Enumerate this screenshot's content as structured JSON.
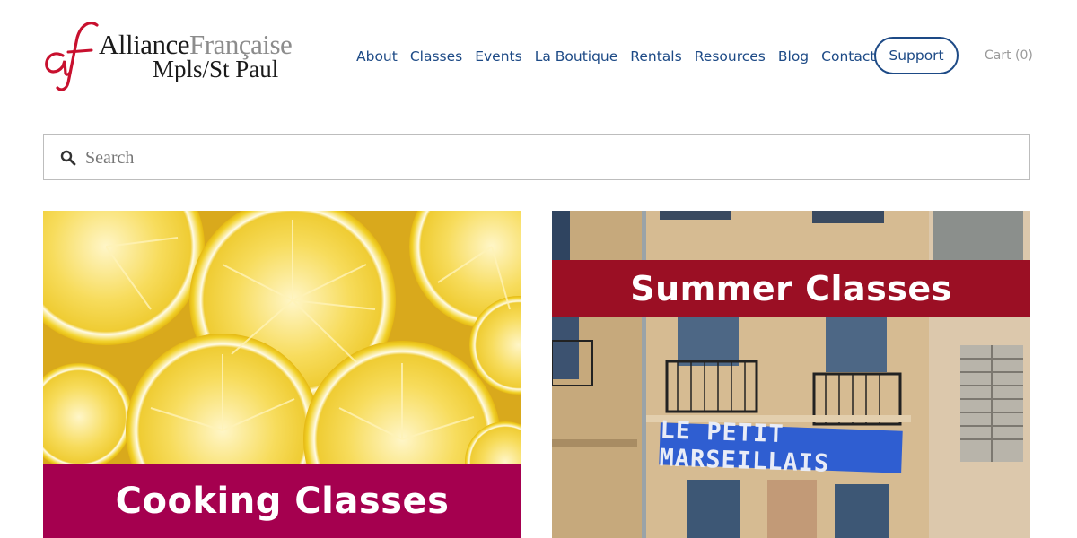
{
  "header": {
    "logo_mark": "af",
    "logo_word_alliance": "Alliance",
    "logo_word_francaise": "Française",
    "logo_line2": "Mpls/St Paul",
    "nav": [
      "About",
      "Classes",
      "Events",
      "La Boutique",
      "Rentals",
      "Resources",
      "Blog",
      "Contact"
    ],
    "support_label": "Support",
    "cart_label": "Cart (0)"
  },
  "search": {
    "placeholder": "Search",
    "icon": "search-icon"
  },
  "cards": [
    {
      "title": "Cooking Classes",
      "banner_color": "#a5004f",
      "image": "lemon-slices"
    },
    {
      "title": "Summer Classes",
      "banner_color": "#9b0f24",
      "image": "french-building-facade",
      "sign_text": "LE PETIT MARSEILLAIS"
    }
  ],
  "colors": {
    "brand_red": "#c8102e",
    "nav_blue": "#1d4a86",
    "cart_gray": "#9a9a9a"
  }
}
